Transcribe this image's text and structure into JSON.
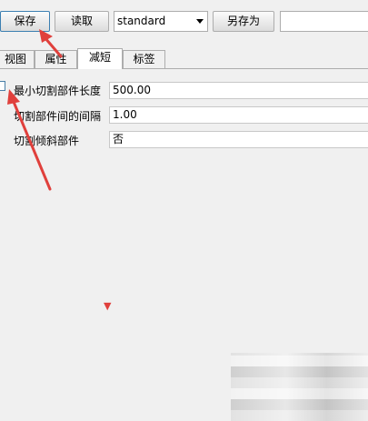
{
  "toolbar": {
    "save_label": "保存",
    "read_label": "读取",
    "preset_value": "standard",
    "save_as_label": "另存为",
    "name_value": ""
  },
  "tabs": [
    {
      "label": "视图",
      "active": false
    },
    {
      "label": "属性",
      "active": false
    },
    {
      "label": "减短",
      "active": true
    },
    {
      "label": "标签",
      "active": false
    }
  ],
  "form": {
    "min_cut_length_label": "最小切割部件长度",
    "min_cut_length_value": "500.00",
    "cut_interval_label": "切割部件间的间隔",
    "cut_interval_value": "1.00",
    "cut_sloped_label": "切割倾斜部件",
    "cut_sloped_value": "否"
  },
  "annotations": {
    "arrow_color": "#e0403c",
    "marker_glyph": "▼"
  }
}
